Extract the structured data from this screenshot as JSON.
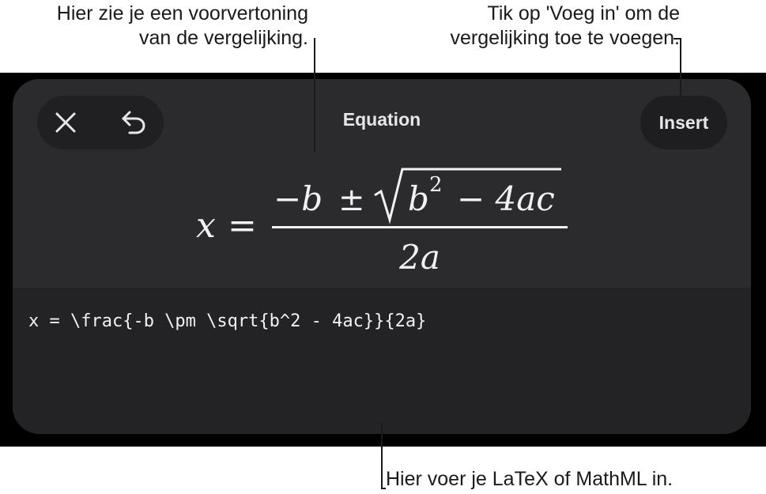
{
  "callouts": {
    "preview": {
      "line1": "Hier zie je een voorvertoning",
      "line2": "van de vergelijking."
    },
    "insert": {
      "line1": "Tik op 'Voeg in' om de",
      "line2": "vergelijking toe te voegen."
    },
    "input": {
      "text": "Hier voer je LaTeX of MathML in."
    }
  },
  "toolbar": {
    "close_icon": "close-icon",
    "undo_icon": "undo-icon",
    "title": "Equation",
    "insert_label": "Insert"
  },
  "preview": {
    "lhs": "x",
    "equals": "=",
    "numerator_minus": "−b",
    "plus_minus": "±",
    "radicand_base": "b",
    "radicand_exponent": "2",
    "radicand_rest": "− 4ac",
    "denominator": "2a"
  },
  "editor": {
    "latex": "x = \\frac{-b \\pm \\sqrt{b^2 - 4ac}}{2a}"
  },
  "colors": {
    "sheet_background": "#2a2a2d",
    "input_background": "#232325",
    "backdrop": "#000000",
    "text": "#f2f2f4"
  }
}
